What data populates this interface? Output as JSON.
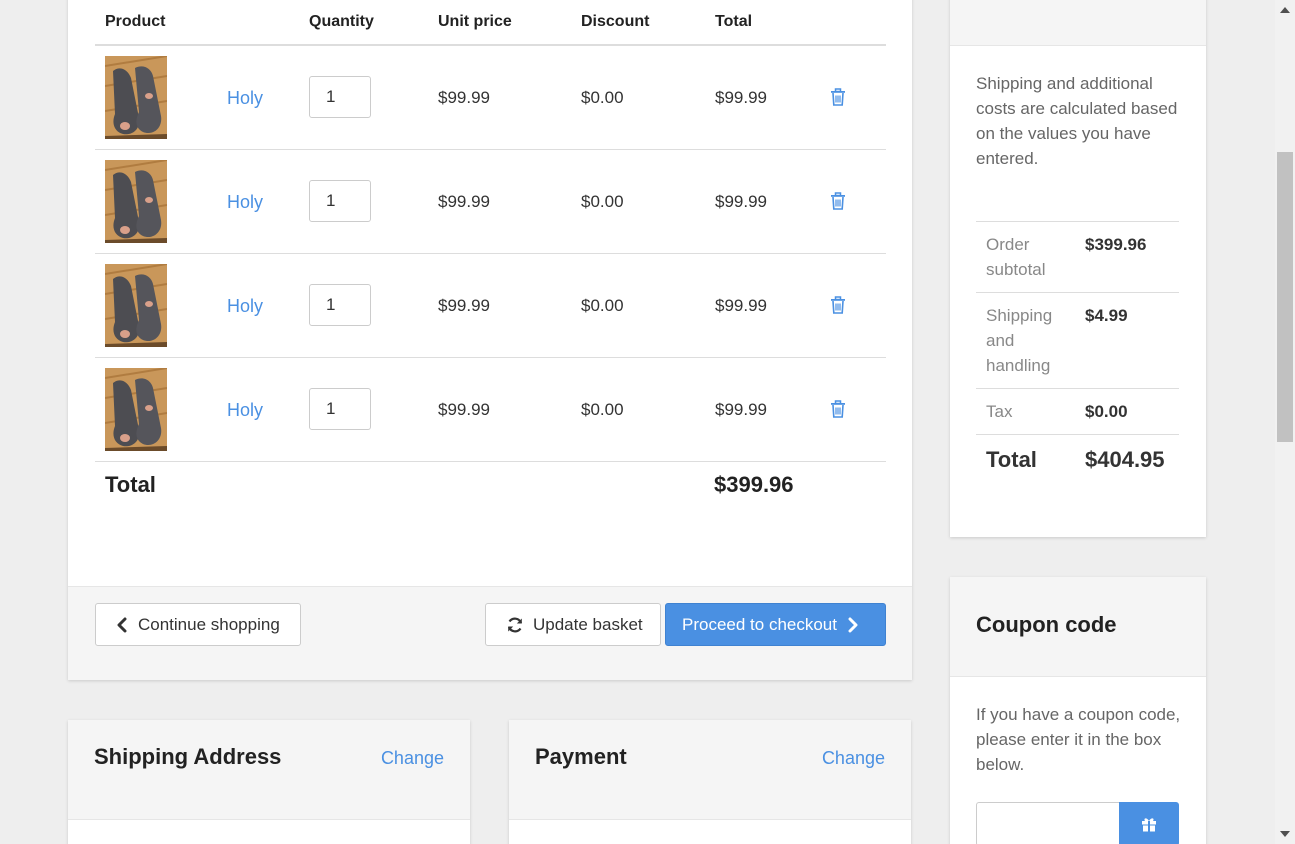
{
  "basket": {
    "columns": {
      "product": "Product",
      "quantity": "Quantity",
      "unit_price": "Unit price",
      "discount": "Discount",
      "total": "Total"
    },
    "rows": [
      {
        "name": "Holy",
        "quantity": "1",
        "unit_price": "$99.99",
        "discount": "$0.00",
        "total": "$99.99"
      },
      {
        "name": "Holy",
        "quantity": "1",
        "unit_price": "$99.99",
        "discount": "$0.00",
        "total": "$99.99"
      },
      {
        "name": "Holy",
        "quantity": "1",
        "unit_price": "$99.99",
        "discount": "$0.00",
        "total": "$99.99"
      },
      {
        "name": "Holy",
        "quantity": "1",
        "unit_price": "$99.99",
        "discount": "$0.00",
        "total": "$99.99"
      }
    ],
    "total_label": "Total",
    "total_value": "$399.96",
    "buttons": {
      "continue": "Continue shopping",
      "update": "Update basket",
      "checkout": "Proceed to checkout"
    }
  },
  "shipping_address": {
    "title": "Shipping Address",
    "change": "Change"
  },
  "payment": {
    "title": "Payment",
    "change": "Change"
  },
  "summary": {
    "note": "Shipping and additional costs are calculated based on the values you have entered.",
    "rows": [
      {
        "label": "Order subtotal",
        "value": "$399.96"
      },
      {
        "label": "Shipping and handling",
        "value": "$4.99"
      },
      {
        "label": "Tax",
        "value": "$0.00"
      }
    ],
    "total_label": "Total",
    "total_value": "$404.95"
  },
  "coupon": {
    "title": "Coupon code",
    "text": "If you have a coupon code, please enter it in the box below.",
    "input_value": ""
  },
  "colors": {
    "accent": "#4a90e2",
    "background": "#eeeeee"
  },
  "icons": {
    "delete": "trash-icon",
    "back": "chevron-left-icon",
    "refresh": "refresh-icon",
    "forward": "chevron-right-icon",
    "coupon": "gift-icon"
  }
}
